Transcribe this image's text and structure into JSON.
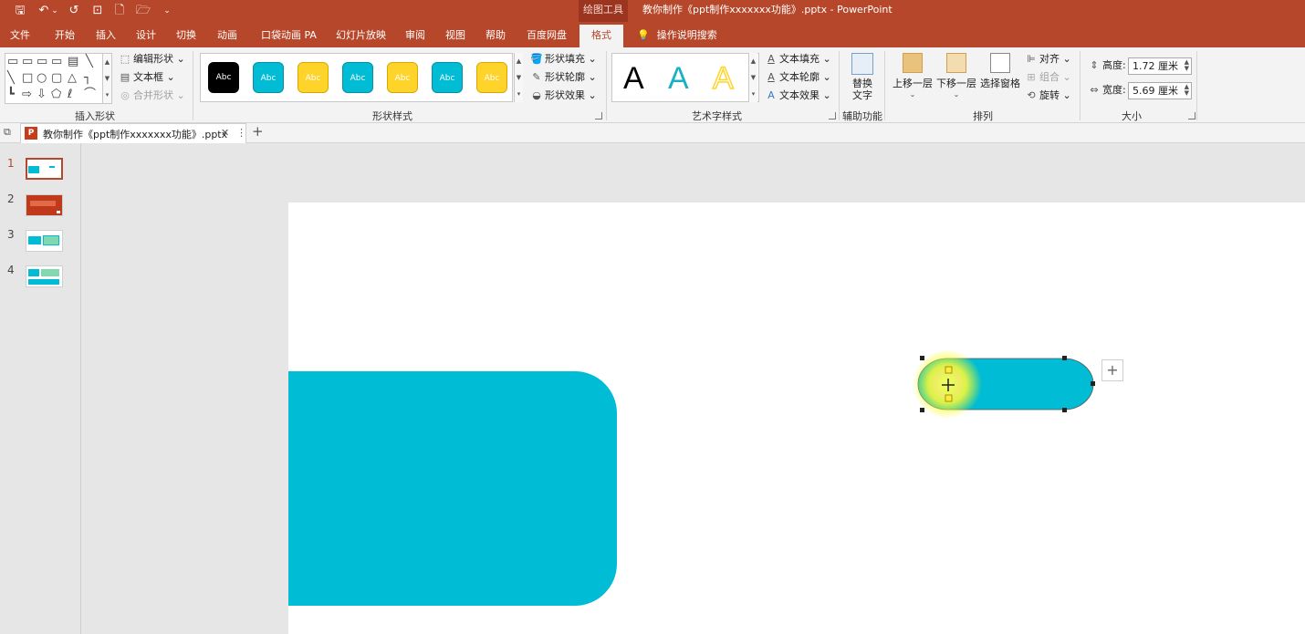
{
  "quick_access": {
    "save_icon": "🖫",
    "undo_icon": "↶",
    "undo_dropdown": "⌄",
    "redo_icon": "↺",
    "slideshow_icon": "⊡",
    "new_icon": "🗋",
    "open_icon": "🗁",
    "customize_icon": "⌄"
  },
  "contextual_group": "绘图工具",
  "window_title": "教你制作《ppt制作xxxxxxx功能》.pptx  -  PowerPoint",
  "tabs": [
    {
      "label": "文件"
    },
    {
      "label": "开始"
    },
    {
      "label": "插入"
    },
    {
      "label": "设计"
    },
    {
      "label": "切换"
    },
    {
      "label": "动画"
    },
    {
      "label": "口袋动画 PA"
    },
    {
      "label": "幻灯片放映"
    },
    {
      "label": "审阅"
    },
    {
      "label": "视图"
    },
    {
      "label": "帮助"
    },
    {
      "label": "百度网盘"
    },
    {
      "label": "格式"
    }
  ],
  "tell_me": "操作说明搜索",
  "ribbon": {
    "insert_shapes": {
      "label": "插入形状",
      "edit_shape": "编辑形状",
      "text_box": "文本框",
      "merge_shapes": "合并形状"
    },
    "shape_styles": {
      "label": "形状样式",
      "sample_text": "Abc",
      "fill": "形状填充",
      "outline": "形状轮廓",
      "effects": "形状效果",
      "swatches": [
        "#000000",
        "#00bcd4",
        "#ffd42a",
        "#00bcd4",
        "#ffd42a",
        "#00bcd4",
        "#ffd42a"
      ]
    },
    "wordart_styles": {
      "label": "艺术字样式",
      "sample": "A",
      "text_fill": "文本填充",
      "text_outline": "文本轮廓",
      "text_effects": "文本效果"
    },
    "accessibility": {
      "label": "辅助功能",
      "alt_text_1": "替换",
      "alt_text_2": "文字"
    },
    "arrange": {
      "label": "排列",
      "bring_forward": "上移一层",
      "send_backward": "下移一层",
      "selection_pane": "选择窗格",
      "align": "对齐",
      "group": "组合",
      "rotate": "旋转"
    },
    "size": {
      "label": "大小",
      "height_label": "高度:",
      "height_value": "1.72 厘米",
      "width_label": "宽度:",
      "width_value": "5.69 厘米"
    }
  },
  "doc_tab": {
    "title": "教你制作《ppt制作xxxxxxx功能》.pptx",
    "close": "✕",
    "menu": "⋮",
    "new_tab": "+"
  },
  "slides": [
    {
      "number": "1"
    },
    {
      "number": "2"
    },
    {
      "number": "3"
    },
    {
      "number": "4"
    }
  ],
  "canvas": {
    "add_button": "+"
  },
  "colors": {
    "accent": "#b7472a",
    "teal": "#00bcd4",
    "yellow": "#ffd42a"
  }
}
